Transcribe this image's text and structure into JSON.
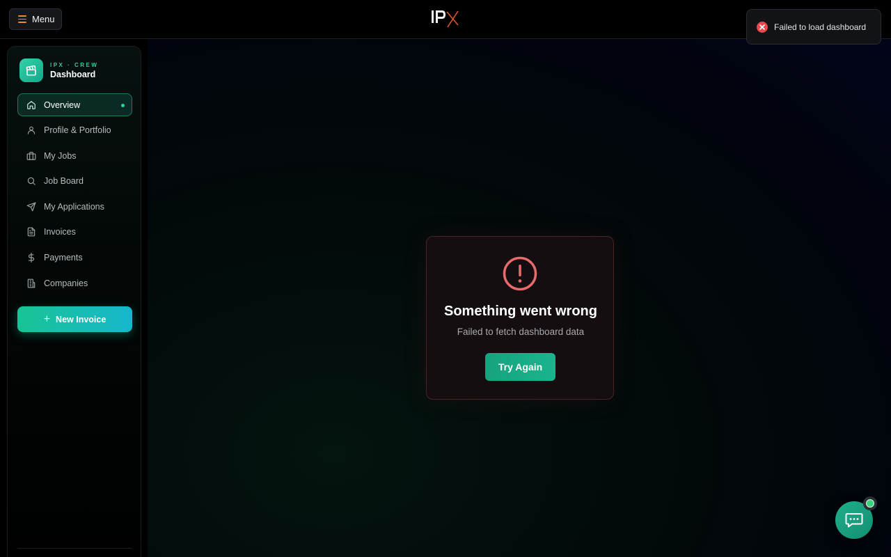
{
  "header": {
    "menu_label": "Menu",
    "logo_alt": "IPX"
  },
  "sidebar": {
    "brand": {
      "subtitle": "IPX · CREW",
      "title": "Dashboard"
    },
    "items": [
      {
        "label": "Overview",
        "icon": "home-icon",
        "active": true
      },
      {
        "label": "Profile & Portfolio",
        "icon": "user-icon"
      },
      {
        "label": "My Jobs",
        "icon": "briefcase-icon"
      },
      {
        "label": "Job Board",
        "icon": "search-icon"
      },
      {
        "label": "My Applications",
        "icon": "send-icon"
      },
      {
        "label": "Invoices",
        "icon": "document-icon"
      },
      {
        "label": "Payments",
        "icon": "dollar-icon"
      },
      {
        "label": "Companies",
        "icon": "building-icon"
      }
    ],
    "new_invoice_label": "New Invoice"
  },
  "error": {
    "title": "Something went wrong",
    "message": "Failed to fetch dashboard data",
    "retry_label": "Try Again"
  },
  "toast": {
    "message": "Failed to load dashboard"
  },
  "colors": {
    "accent": "#18c494",
    "error": "#e5484d",
    "menu_icon": "#f08a2e"
  }
}
